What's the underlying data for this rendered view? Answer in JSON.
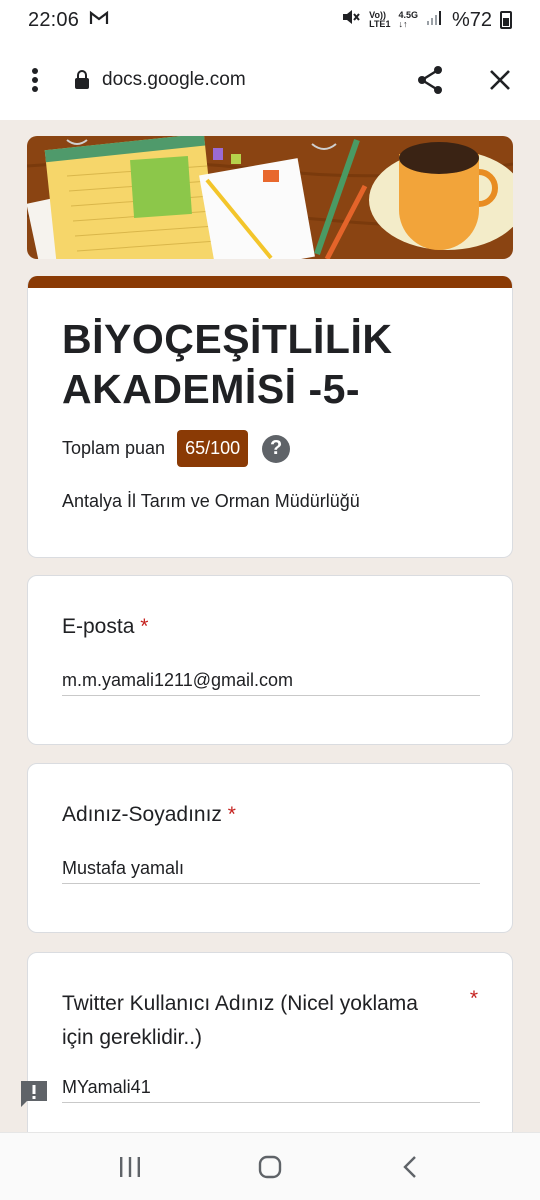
{
  "status_bar": {
    "time": "22:06",
    "network_top": "4.5G",
    "network_bottom": "LTE1",
    "volte": "Vo))",
    "battery": "%72",
    "icons": [
      "gmail-icon",
      "mute-icon",
      "signal-icon",
      "battery-icon"
    ]
  },
  "browser": {
    "url": "docs.google.com",
    "icons": [
      "menu-dots-icon",
      "lock-icon",
      "share-icon",
      "close-icon"
    ]
  },
  "form": {
    "title": "BİYOÇEŞİTLİLİK AKADEMİSİ -5-",
    "score_label": "Toplam puan",
    "score_value": "65/100",
    "help_symbol": "?",
    "description": "Antalya İl Tarım ve Orman Müdürlüğü",
    "accent_color": "#8a3a05",
    "questions": [
      {
        "label": "E-posta",
        "required_mark": "*",
        "answer": "m.m.yamali1211@gmail.com"
      },
      {
        "label": "Adınız-Soyadınız",
        "required_mark": "*",
        "answer": "Mustafa yamalı"
      },
      {
        "label": "Twitter Kullanıcı Adınız (Nicel yoklama için gereklidir..)",
        "required_mark": "*",
        "answer": "MYamali41"
      }
    ]
  },
  "nav_bar": {
    "icons": [
      "recent-apps-icon",
      "home-icon",
      "back-icon"
    ]
  }
}
